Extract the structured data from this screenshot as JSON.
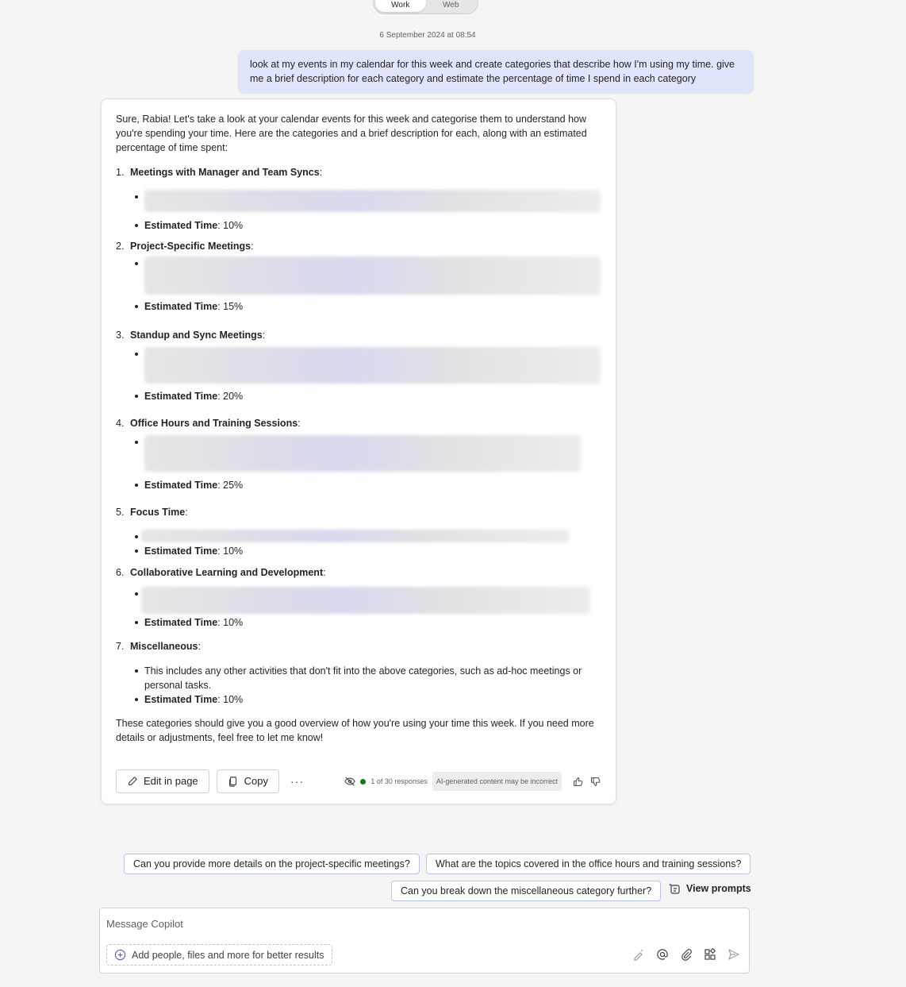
{
  "toggle": {
    "work": "Work",
    "web": "Web"
  },
  "timestamp": "6 September 2024 at 08:54",
  "user_message": "look at my events in my calendar for this week and create categories that describe how I'm using my time. give me a brief description for each category and estimate the percentage of time I spend in each category",
  "response": {
    "intro": "Sure, Rabia! Let's take a look at your calendar events for this week and categorise them to understand how you're spending your time. Here are the categories and a brief description for each, along with an estimated percentage of time spent:",
    "estimated_label": "Estimated Time",
    "categories": [
      {
        "num": "1.",
        "title": "Meetings with Manager and Team Syncs",
        "estimate": ": 10%"
      },
      {
        "num": "2.",
        "title": "Project-Specific Meetings",
        "estimate": ": 15%"
      },
      {
        "num": "3.",
        "title": "Standup and Sync Meetings",
        "estimate": ": 20%"
      },
      {
        "num": "4.",
        "title": "Office Hours and Training Sessions",
        "estimate": ": 25%"
      },
      {
        "num": "5.",
        "title": "Focus Time",
        "estimate": ": 10%"
      },
      {
        "num": "6.",
        "title": "Collaborative Learning and Development",
        "estimate": ": 10%"
      },
      {
        "num": "7.",
        "title": "Miscellaneous",
        "estimate": ": 10%",
        "description": "This includes any other activities that don't fit into the above categories, such as ad-hoc meetings or personal tasks."
      }
    ],
    "colon": ":",
    "outro": "These categories should give you a good overview of how you're using your time this week. If you need more details or adjustments, feel free to let me know!"
  },
  "actions": {
    "edit_label": "Edit in page",
    "copy_label": "Copy",
    "more_label": "···",
    "responses_count": "1 of 30 responses",
    "ai_disclaimer": "AI-generated content may be incorrect"
  },
  "suggestions": {
    "s1": "Can you provide more details on the project-specific meetings?",
    "s2": "What are the topics covered in the office hours and training sessions?",
    "s3": "Can you break down the miscellaneous category further?",
    "view_prompts": "View prompts"
  },
  "composer": {
    "placeholder": "Message Copilot",
    "add_people": "Add people, files and more for better results"
  },
  "colors": {
    "accent": "#e1e5fc",
    "status_green": "#0f7b0f"
  }
}
